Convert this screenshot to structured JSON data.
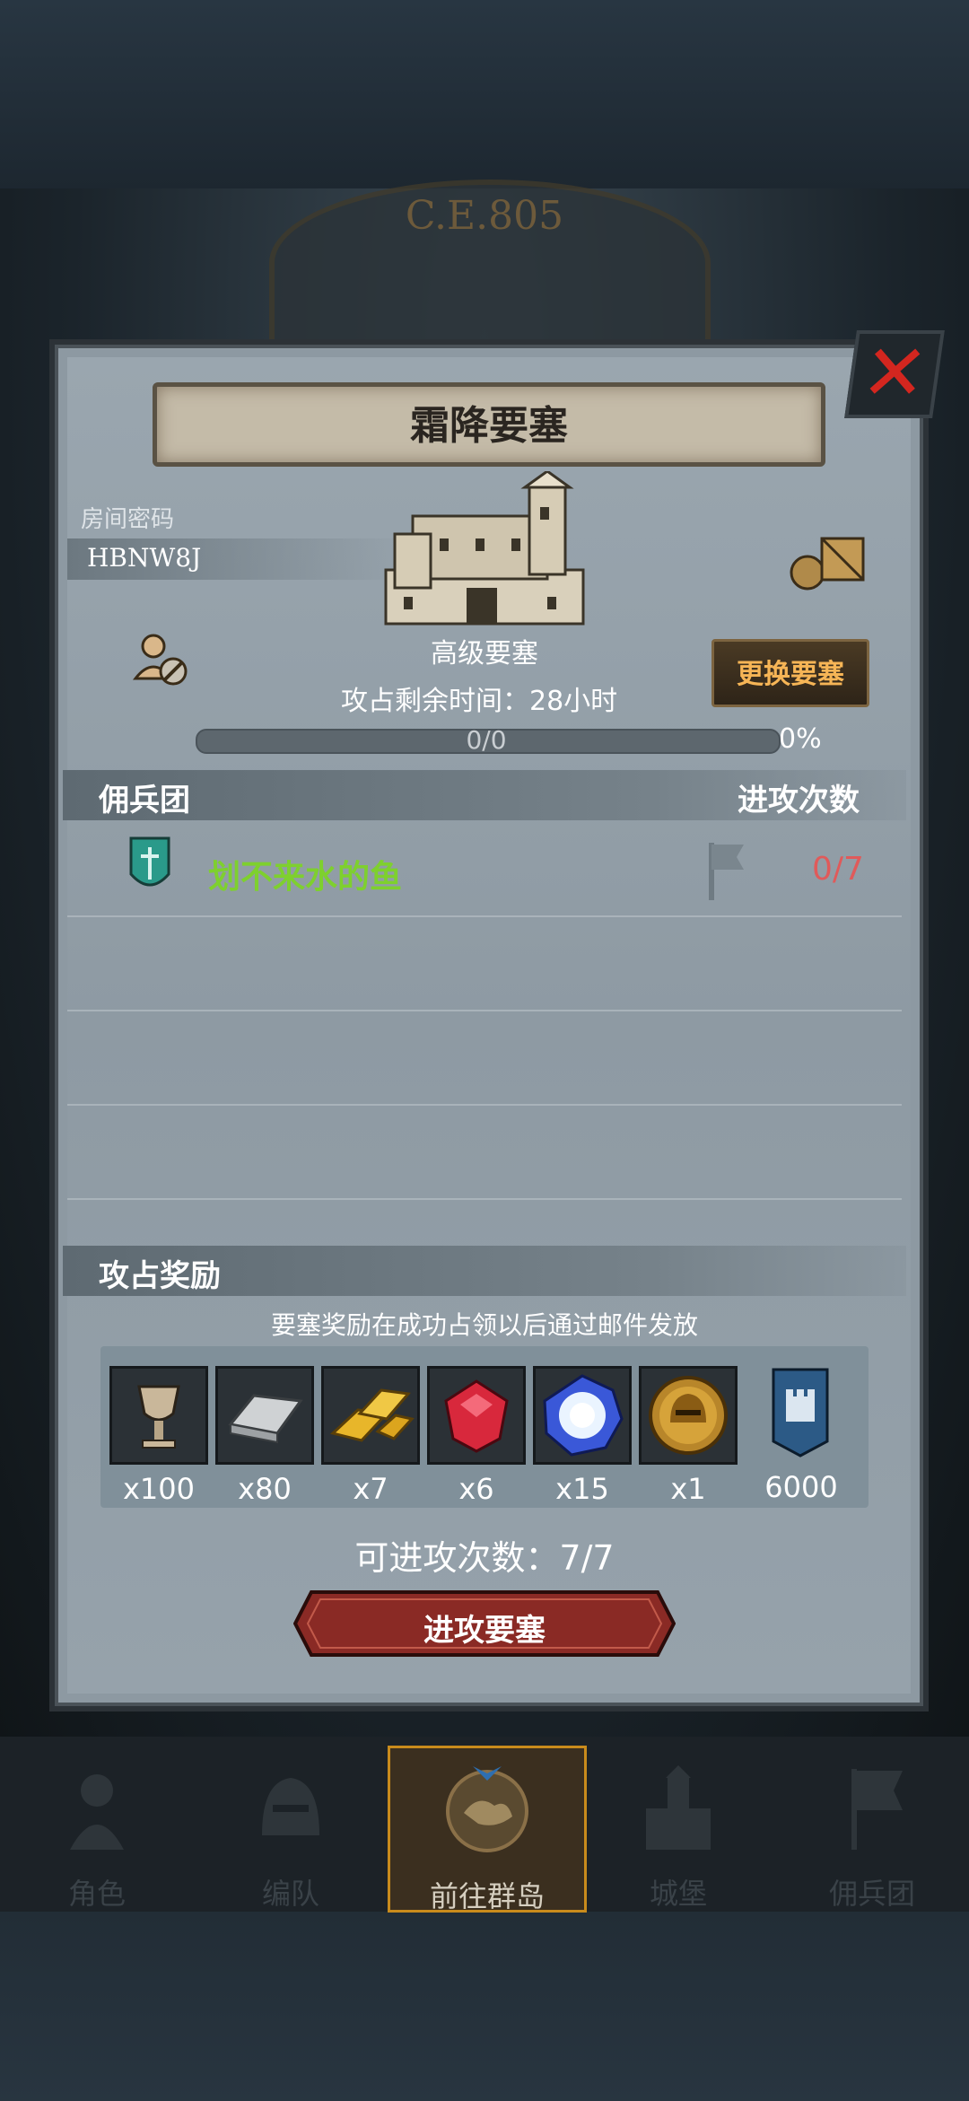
{
  "era": "C.E.805",
  "dialog": {
    "title": "霜降要塞",
    "room": {
      "label": "房间密码",
      "code": "HBNW8J"
    },
    "fortress_grade": "高级要塞",
    "change_button": "更换要塞",
    "remaining_time": "攻占剩余时间：28小时",
    "progress": {
      "count_text": "0/0",
      "percent_text": "0%",
      "fraction": 0
    },
    "mercenary_header": "佣兵团",
    "attack_count_header": "进攻次数",
    "guilds": [
      {
        "name": "划不来水的鱼",
        "attacks": "0/7"
      }
    ],
    "rewards_header": "攻占奖励",
    "rewards_note": "要塞奖励在成功占领以后通过邮件发放",
    "rewards": [
      {
        "icon": "chalice-icon",
        "qty": "x100"
      },
      {
        "icon": "iron-ingot-icon",
        "qty": "x80"
      },
      {
        "icon": "gold-bars-icon",
        "qty": "x7"
      },
      {
        "icon": "ruby-icon",
        "qty": "x6"
      },
      {
        "icon": "crystal-orb-icon",
        "qty": "x15"
      },
      {
        "icon": "helmet-coin-icon",
        "qty": "x1"
      },
      {
        "icon": "fortress-banner-icon",
        "qty": "6000"
      }
    ],
    "attack_times": "可进攻次数：7/7",
    "attack_button": "进攻要塞"
  },
  "nav": [
    {
      "label": "角色",
      "icon": "knight-icon"
    },
    {
      "label": "编队",
      "icon": "helmet-icon"
    },
    {
      "label": "前往群岛",
      "icon": "island-compass-icon",
      "active": true
    },
    {
      "label": "城堡",
      "icon": "castle-icon"
    },
    {
      "label": "佣兵团",
      "icon": "banner-icon"
    }
  ],
  "colors": {
    "guild_name": "#7ed02e",
    "attack_count": "#e05a5a",
    "change_button_text": "#f6b556",
    "close_x": "#d3261f",
    "attack_button": "#8a2a25"
  }
}
